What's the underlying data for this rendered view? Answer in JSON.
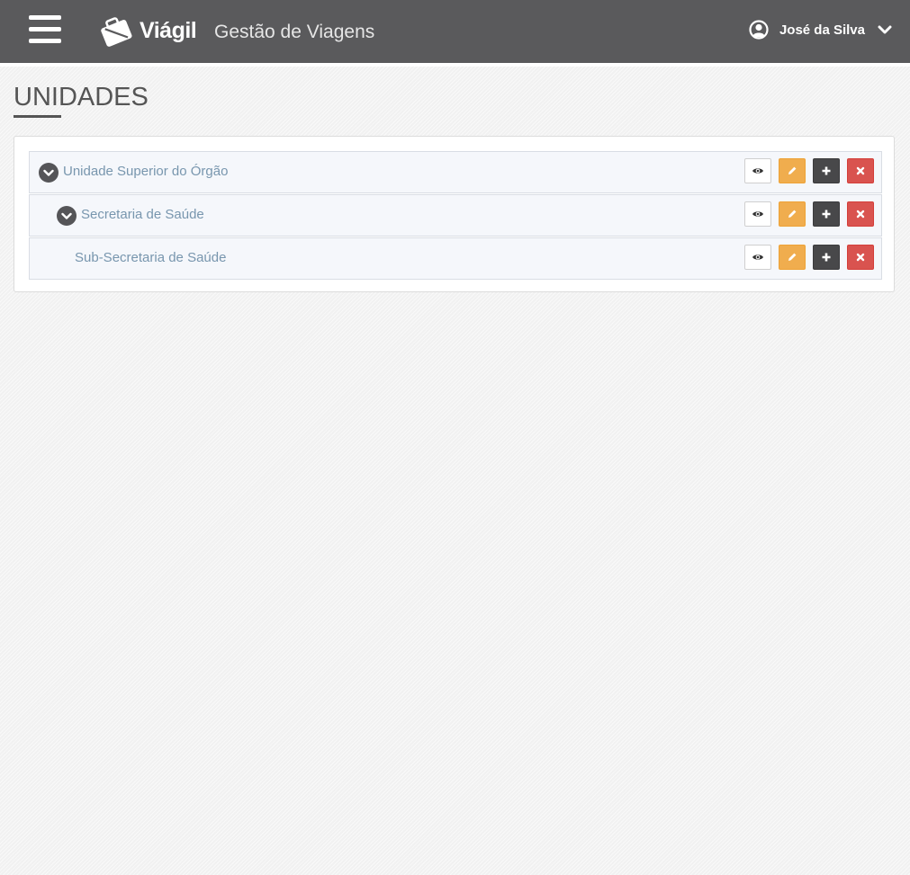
{
  "header": {
    "brand": "Viágil",
    "app_title": "Gestão de Viagens",
    "user_name": "José da Silva"
  },
  "page": {
    "title": "UNIDADES"
  },
  "units": [
    {
      "label": "Unidade Superior do Órgão",
      "level": 0,
      "expanded": true
    },
    {
      "label": "Secretaria de Saúde",
      "level": 1,
      "expanded": true
    },
    {
      "label": "Sub-Secretaria de Saúde",
      "level": 2,
      "expanded": false
    }
  ],
  "actions": {
    "view_icon": "eye-icon",
    "edit_icon": "pencil-icon",
    "add_icon": "plus-icon",
    "delete_icon": "close-icon"
  },
  "colors": {
    "header_bg": "#5a5a5c",
    "link": "#7896ae",
    "edit": "#f0ad4e",
    "add": "#48484a",
    "delete": "#d9534f"
  }
}
